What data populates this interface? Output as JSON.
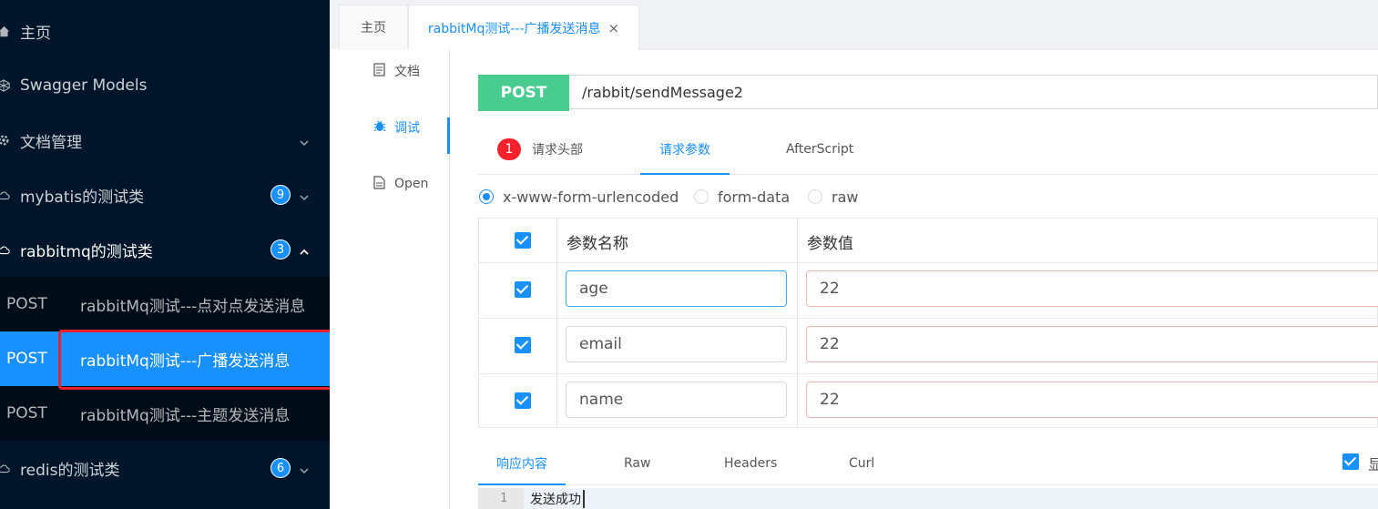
{
  "sidebar": {
    "items": [
      {
        "label": "主页",
        "icon": "home-icon"
      },
      {
        "label": "Swagger Models",
        "icon": "codepen-icon"
      },
      {
        "label": "文档管理",
        "icon": "gear-icon"
      },
      {
        "label": "mybatis的测试类",
        "icon": "cloud-icon",
        "badge": "9"
      },
      {
        "label": "rabbitmq的测试类",
        "icon": "cloud-icon",
        "badge": "3"
      },
      {
        "label": "redis的测试类",
        "icon": "cloud-icon",
        "badge": "6"
      }
    ],
    "sub_items": [
      {
        "method": "POST",
        "title": "rabbitMq测试---点对点发送消息"
      },
      {
        "method": "POST",
        "title": "rabbitMq测试---广播发送消息"
      },
      {
        "method": "POST",
        "title": "rabbitMq测试---主题发送消息"
      }
    ]
  },
  "tabs": [
    {
      "label": "主页"
    },
    {
      "label": "rabbitMq测试---广播发送消息",
      "close": "×"
    }
  ],
  "doc_tabs": [
    {
      "label": "文档",
      "icon": "file-icon"
    },
    {
      "label": "调试",
      "icon": "bug-icon"
    },
    {
      "label": "Open",
      "icon": "file-text-icon"
    }
  ],
  "request": {
    "method": "POST",
    "url": "/rabbit/sendMessage2",
    "method_color": "#49cc90"
  },
  "req_tabs": [
    {
      "label": "请求头部",
      "badge": "1"
    },
    {
      "label": "请求参数"
    },
    {
      "label": "AfterScript"
    }
  ],
  "body_types": [
    "x-www-form-urlencoded",
    "form-data",
    "raw"
  ],
  "params": {
    "headers": [
      "参数名称",
      "参数值"
    ],
    "rows": [
      {
        "name": "age",
        "value": "22"
      },
      {
        "name": "email",
        "value": "22"
      },
      {
        "name": "name",
        "value": "22"
      }
    ]
  },
  "resp_tabs": [
    "响应内容",
    "Raw",
    "Headers",
    "Curl"
  ],
  "resp_check_label": "显",
  "response": {
    "line_no": "1",
    "text": "发送成功"
  },
  "colors": {
    "sidebar_bg": "#001529",
    "accent": "#1890ff",
    "highlight": "#e8232b"
  }
}
